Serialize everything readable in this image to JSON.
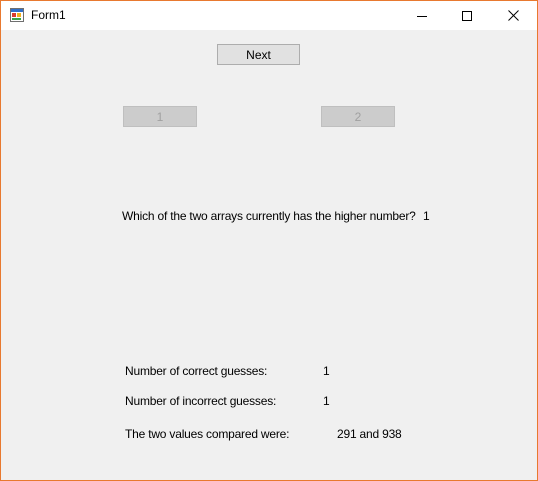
{
  "window": {
    "title": "Form1",
    "icon": "winforms-app-icon",
    "controls": {
      "minimize_icon": "minimize-icon",
      "maximize_icon": "maximize-icon",
      "close_icon": "close-icon"
    }
  },
  "form": {
    "next_button": "Next",
    "choice_button_1": "1",
    "choice_button_2": "2",
    "question_label": "Which of the two arrays currently has the higher number?",
    "question_answer": "1",
    "correct_label": "Number of correct guesses:",
    "correct_value": "1",
    "incorrect_label": "Number of incorrect guesses:",
    "incorrect_value": "1",
    "compared_label": "The two values compared were:",
    "compared_value": "291 and 938"
  },
  "colors": {
    "window_border": "#e8792f",
    "client_background": "#f0f0f0",
    "button_background": "#e1e1e1",
    "disabled_button_background": "#cccccc"
  }
}
